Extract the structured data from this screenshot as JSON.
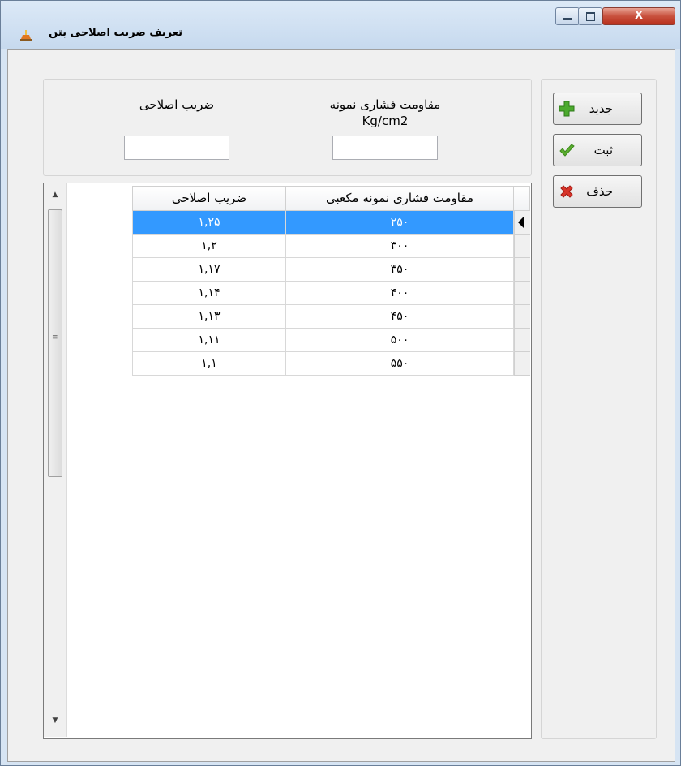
{
  "window": {
    "title": "تعریف ضریب اصلاحی بتن",
    "close_glyph": "X"
  },
  "form": {
    "correction_label": "ضریب اصلاحی",
    "strength_label_line1": "مقاومت فشاری نمونه",
    "strength_label_line2": "Kg/cm2",
    "correction_value": "",
    "strength_value": ""
  },
  "buttons": {
    "new_label": "جدید",
    "save_label": "ثبت",
    "delete_label": "حذف"
  },
  "grid": {
    "columns": [
      "مقاومت فشاری نمونه مکعبی",
      "ضریب اصلاحی"
    ],
    "rows": [
      {
        "strength": "۲۵۰",
        "coef": "۱,۲۵",
        "selected": true
      },
      {
        "strength": "۳۰۰",
        "coef": "۱,۲",
        "selected": false
      },
      {
        "strength": "۳۵۰",
        "coef": "۱,۱۷",
        "selected": false
      },
      {
        "strength": "۴۰۰",
        "coef": "۱,۱۴",
        "selected": false
      },
      {
        "strength": "۴۵۰",
        "coef": "۱,۱۳",
        "selected": false
      },
      {
        "strength": "۵۰۰",
        "coef": "۱,۱۱",
        "selected": false
      },
      {
        "strength": "۵۵۰",
        "coef": "۱,۱",
        "selected": false
      }
    ]
  },
  "colors": {
    "selection": "#3399ff",
    "close_button": "#c8513e"
  }
}
